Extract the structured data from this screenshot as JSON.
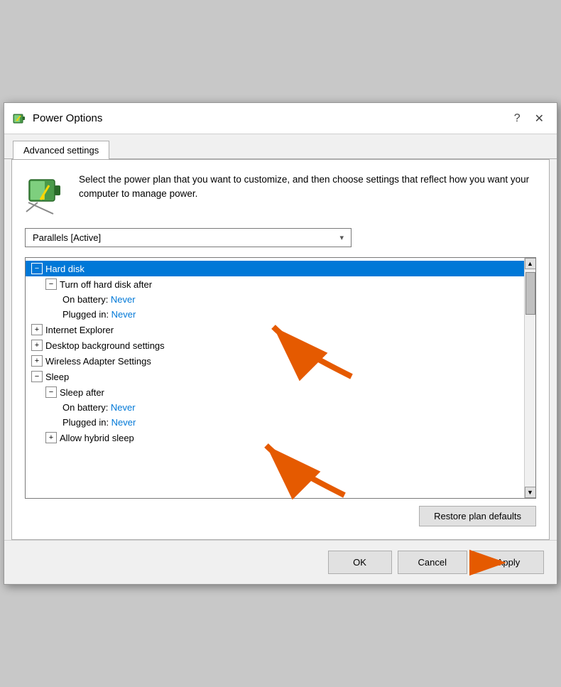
{
  "titleBar": {
    "title": "Power Options",
    "helpBtn": "?",
    "closeBtn": "✕"
  },
  "tabs": [
    {
      "label": "Advanced settings"
    }
  ],
  "description": "Select the power plan that you want to customize, and then choose settings that reflect how you want your computer to manage power.",
  "dropdown": {
    "value": "Parallels [Active]"
  },
  "treeItems": [
    {
      "id": "hard-disk",
      "indent": 0,
      "expander": "−",
      "text": "Hard disk",
      "value": "",
      "selected": true
    },
    {
      "id": "turn-off",
      "indent": 1,
      "expander": "−",
      "text": "Turn off hard disk after",
      "value": ""
    },
    {
      "id": "on-battery",
      "indent": 2,
      "expander": null,
      "text": "On battery: ",
      "value": "Never"
    },
    {
      "id": "plugged-in-1",
      "indent": 2,
      "expander": null,
      "text": "Plugged in: ",
      "value": "Never"
    },
    {
      "id": "internet-explorer",
      "indent": 0,
      "expander": "+",
      "text": "Internet Explorer",
      "value": ""
    },
    {
      "id": "desktop-bg",
      "indent": 0,
      "expander": "+",
      "text": "Desktop background settings",
      "value": ""
    },
    {
      "id": "wireless",
      "indent": 0,
      "expander": "+",
      "text": "Wireless Adapter Settings",
      "value": ""
    },
    {
      "id": "sleep",
      "indent": 0,
      "expander": "−",
      "text": "Sleep",
      "value": ""
    },
    {
      "id": "sleep-after",
      "indent": 1,
      "expander": "−",
      "text": "Sleep after",
      "value": ""
    },
    {
      "id": "sleep-battery",
      "indent": 2,
      "expander": null,
      "text": "On battery: ",
      "value": "Never"
    },
    {
      "id": "sleep-plugged",
      "indent": 2,
      "expander": null,
      "text": "Plugged in: ",
      "value": "Never"
    },
    {
      "id": "hybrid-sleep",
      "indent": 1,
      "expander": "+",
      "text": "Allow hybrid sleep",
      "value": ""
    }
  ],
  "restoreBtn": "Restore plan defaults",
  "footer": {
    "okLabel": "OK",
    "cancelLabel": "Cancel",
    "applyLabel": "Apply"
  }
}
